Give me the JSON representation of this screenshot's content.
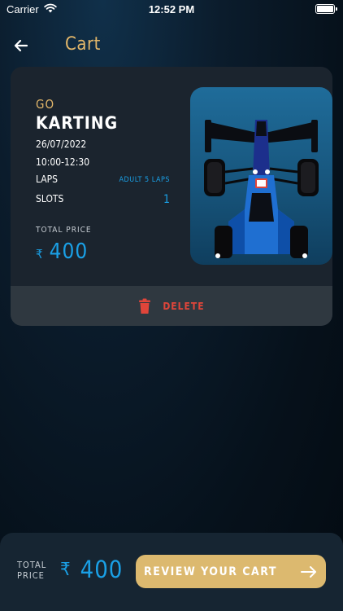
{
  "status_bar": {
    "carrier": "Carrier",
    "time": "12:52 PM"
  },
  "nav": {
    "title": "Cart"
  },
  "cart_item": {
    "category": "GO",
    "title": "KARTING",
    "date": "26/07/2022",
    "time": "10:00-12:30",
    "laps_label": "LAPS",
    "laps_value": "ADULT 5 LAPS",
    "slots_label": "SLOTS",
    "slots_value": "1",
    "total_label": "TOTAL PRICE",
    "currency": "₹",
    "total_amount": "400",
    "delete_label": "DELETE",
    "image": "race-car-image"
  },
  "footer": {
    "total_label": "TOTAL PRICE",
    "currency": "₹",
    "total_amount": "400",
    "review_label": "REVIEW YOUR CART"
  },
  "colors": {
    "accent_gold": "#e3b76a",
    "accent_blue": "#1aa0e6",
    "delete_red": "#e0453a",
    "button_gold": "#dcb96f",
    "card_bg": "#1b242e"
  },
  "icons": [
    "back-arrow-icon",
    "trash-icon",
    "arrow-right-icon",
    "wifi-icon",
    "battery-icon"
  ]
}
